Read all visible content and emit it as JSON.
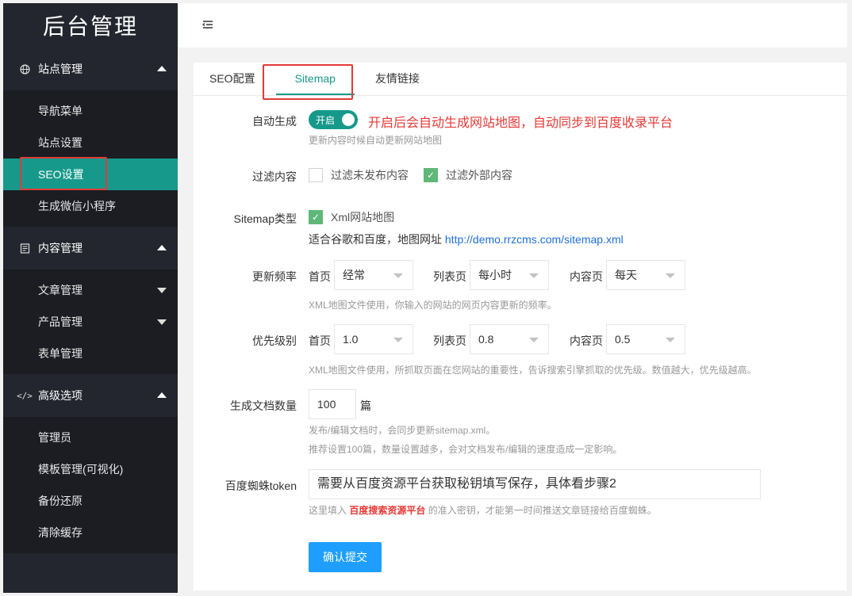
{
  "sidebar": {
    "logo": "后台管理",
    "groups": [
      {
        "label": "站点管理",
        "icon": "globe-icon",
        "items": [
          {
            "label": "导航菜单"
          },
          {
            "label": "站点设置"
          },
          {
            "label": "SEO设置"
          },
          {
            "label": "生成微信小程序"
          }
        ]
      },
      {
        "label": "内容管理",
        "icon": "document-icon",
        "items": [
          {
            "label": "文章管理"
          },
          {
            "label": "产品管理"
          },
          {
            "label": "表单管理"
          }
        ]
      },
      {
        "label": "高级选项",
        "icon": "code-icon",
        "items": [
          {
            "label": "管理员"
          },
          {
            "label": "模板管理(可视化)"
          },
          {
            "label": "备份还原"
          },
          {
            "label": "清除缓存"
          }
        ]
      }
    ],
    "active_item": "SEO设置"
  },
  "header": {
    "menu_toggle_icon": "menu-indent-icon"
  },
  "tabs": [
    {
      "label": "SEO配置"
    },
    {
      "label": "Sitemap"
    },
    {
      "label": "友情链接"
    }
  ],
  "active_tab": "Sitemap",
  "form": {
    "auto_generate": {
      "label": "自动生成",
      "switch_text": "开启",
      "note": "开启后会自动生成网站地图，自动同步到百度收录平台",
      "hint": "更新内容时候自动更新网站地图"
    },
    "filter": {
      "label": "过滤内容",
      "options": [
        {
          "label": "过滤未发布内容",
          "checked": false
        },
        {
          "label": "过滤外部内容",
          "checked": true
        }
      ]
    },
    "sitemap_type": {
      "label": "Sitemap类型",
      "option": "Xml网站地图",
      "checked": true,
      "desc": "适合谷歌和百度，地图网址",
      "url": "http://demo.rrzcms.com/sitemap.xml"
    },
    "frequency": {
      "label": "更新频率",
      "home_label": "首页",
      "home_value": "经常",
      "list_label": "列表页",
      "list_value": "每小时",
      "content_label": "内容页",
      "content_value": "每天",
      "hint": "XML地图文件使用，你输入的网站的网页内容更新的频率。"
    },
    "priority": {
      "label": "优先级别",
      "home_label": "首页",
      "home_value": "1.0",
      "list_label": "列表页",
      "list_value": "0.8",
      "content_label": "内容页",
      "content_value": "0.5",
      "hint": "XML地图文件使用，所抓取页面在您网站的重要性，告诉搜索引擎抓取的优先级。数值越大，优先级越高。"
    },
    "doc_count": {
      "label": "生成文档数量",
      "value": "100",
      "unit": "篇",
      "hint1": "发布/编辑文档时，会同步更新sitemap.xml。",
      "hint2": "推荐设置100篇，数量设置越多，会对文档发布/编辑的速度造成一定影响。"
    },
    "baidu_token": {
      "label": "百度蜘蛛token",
      "value": "需要从百度资源平台获取秘钥填写保存，具体看步骤2",
      "hint_pre": "这里填入",
      "hint_link": "百度搜索资源平台",
      "hint_post": "的准入密钥，才能第一时间推送文章链接给百度蜘蛛。"
    },
    "submit_label": "确认提交"
  },
  "colors": {
    "sidebar_bg": "#23262e",
    "active_green": "#16998a",
    "primary_blue": "#1e9fff",
    "highlight_red": "#e53935"
  }
}
